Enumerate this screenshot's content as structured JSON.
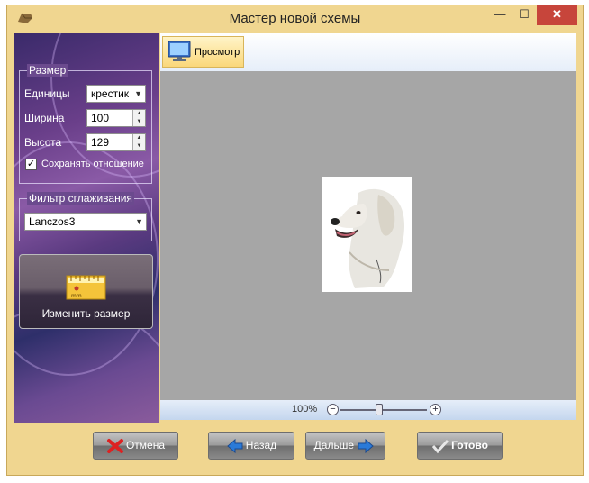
{
  "window": {
    "title": "Мастер новой схемы",
    "min_label": "—",
    "max_label": "☐",
    "close_label": "✕"
  },
  "size_group": {
    "legend": "Размер",
    "units_label": "Единицы",
    "units_value": "крестик",
    "width_label": "Ширина",
    "width_value": "100",
    "height_label": "Высота",
    "height_value": "129",
    "keep_ratio_label": "Сохранять отношение",
    "keep_ratio_checked": true
  },
  "filter_group": {
    "legend": "Фильтр сглаживания",
    "value": "Lanczos3"
  },
  "resize_button": {
    "label": "Изменить размер",
    "ruler_text": "mm"
  },
  "toolbar": {
    "preview_label": "Просмотр"
  },
  "zoom": {
    "percent": "100%",
    "level": 0.45
  },
  "buttons": {
    "cancel": "Отмена",
    "back": "Назад",
    "next": "Дальше",
    "done": "Готово"
  },
  "icons": [
    "app-icon",
    "monitor-icon",
    "ruler-icon",
    "cancel-x-icon",
    "back-arrow-icon",
    "next-arrow-icon",
    "check-icon",
    "zoom-minus-icon",
    "zoom-plus-icon"
  ]
}
